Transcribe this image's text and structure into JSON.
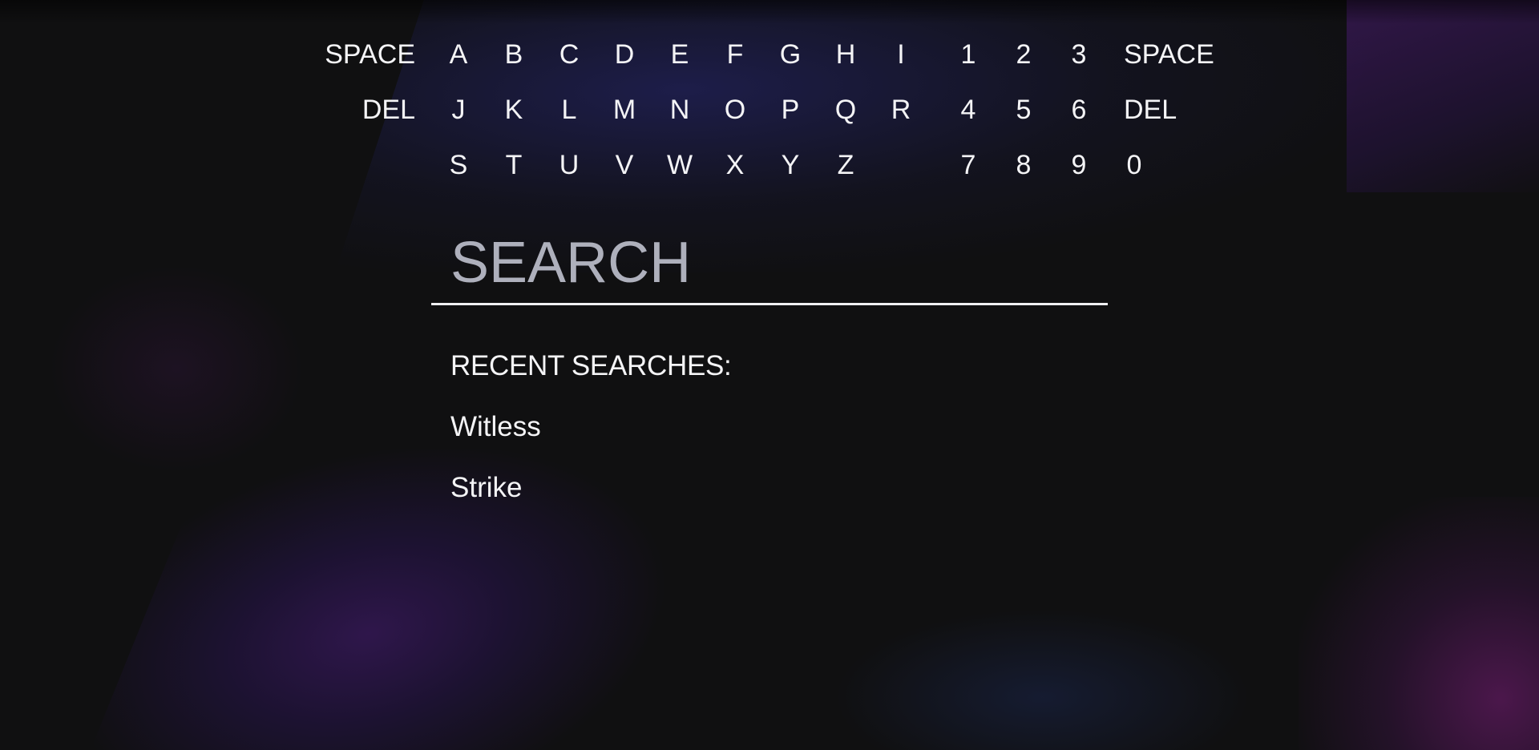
{
  "keyboard": {
    "row1": {
      "left_action": "SPACE",
      "letters": [
        "A",
        "B",
        "C",
        "D",
        "E",
        "F",
        "G",
        "H",
        "I"
      ],
      "digits": [
        "1",
        "2",
        "3"
      ],
      "right_action": "SPACE"
    },
    "row2": {
      "left_action": "DEL",
      "letters": [
        "J",
        "K",
        "L",
        "M",
        "N",
        "O",
        "P",
        "Q",
        "R"
      ],
      "digits": [
        "4",
        "5",
        "6"
      ],
      "right_action": "DEL"
    },
    "row3": {
      "letters": [
        "S",
        "T",
        "U",
        "V",
        "W",
        "X",
        "Y",
        "Z"
      ],
      "digits": [
        "7",
        "8",
        "9",
        "0"
      ]
    }
  },
  "search": {
    "placeholder": "SEARCH",
    "value": ""
  },
  "recent_searches": {
    "heading": "RECENT SEARCHES:",
    "items": [
      "Witless",
      "Strike"
    ]
  },
  "colors": {
    "background": "#101011",
    "text": "#f4f4f6",
    "placeholder": "#aeb0bc",
    "underline": "#f0f0f2",
    "accent_purple": "#3c1964",
    "accent_blue": "#28287a"
  }
}
